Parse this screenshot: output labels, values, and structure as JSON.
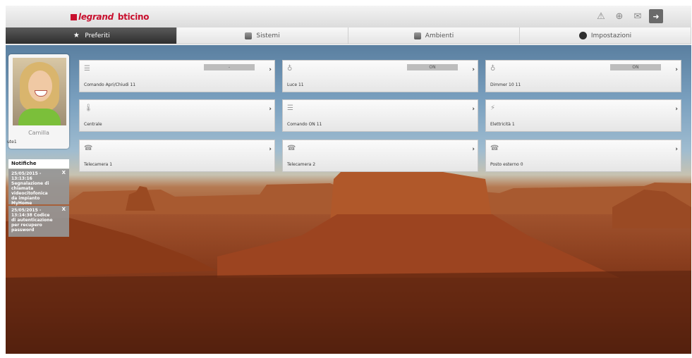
{
  "brand": {
    "logo_left": "legrand",
    "logo_right": "bticino"
  },
  "top_icons": [
    "warning-icon",
    "lock-icon",
    "mail-icon",
    "exit-icon"
  ],
  "tabs": [
    {
      "label": "Preferiti",
      "icon": "star-icon",
      "active": true
    },
    {
      "label": "Sistemi",
      "icon": "systems-icon",
      "active": false
    },
    {
      "label": "Ambienti",
      "icon": "rooms-icon",
      "active": false
    },
    {
      "label": "Impostazioni",
      "icon": "settings-icon",
      "active": false
    }
  ],
  "profile": {
    "name": "Camilla",
    "user": "ute1"
  },
  "notifications": {
    "title": "Notifiche",
    "close_label": "X",
    "items": [
      {
        "text": "25/05/2015 - 13:13:16 Segnalazione di chiamata videocitofonica da impianto MyHome"
      },
      {
        "text": "25/05/2015 - 13:14:38 Codice di autenticazione per recupero password"
      }
    ]
  },
  "tiles": [
    {
      "label": "Comando Apri/Chiudi 11",
      "state": "-",
      "icon": "shutter-icon"
    },
    {
      "label": "Luce 11",
      "state": "ON",
      "icon": "bulb-icon"
    },
    {
      "label": "Dimmer 10 11",
      "state": "ON",
      "icon": "bulb-icon"
    },
    {
      "label": "Centrale",
      "state": "",
      "icon": "thermometer-icon"
    },
    {
      "label": "Comando ON 11",
      "state": "",
      "icon": "shutter-icon"
    },
    {
      "label": "Elettricità 1",
      "state": "",
      "icon": "energy-icon"
    },
    {
      "label": "Telecamera 1",
      "state": "",
      "icon": "videophone-icon"
    },
    {
      "label": "Telecamera 2",
      "state": "",
      "icon": "videophone-icon"
    },
    {
      "label": "Posto esterno 0",
      "state": "",
      "icon": "videophone-icon"
    }
  ],
  "tile_arrow": "›"
}
